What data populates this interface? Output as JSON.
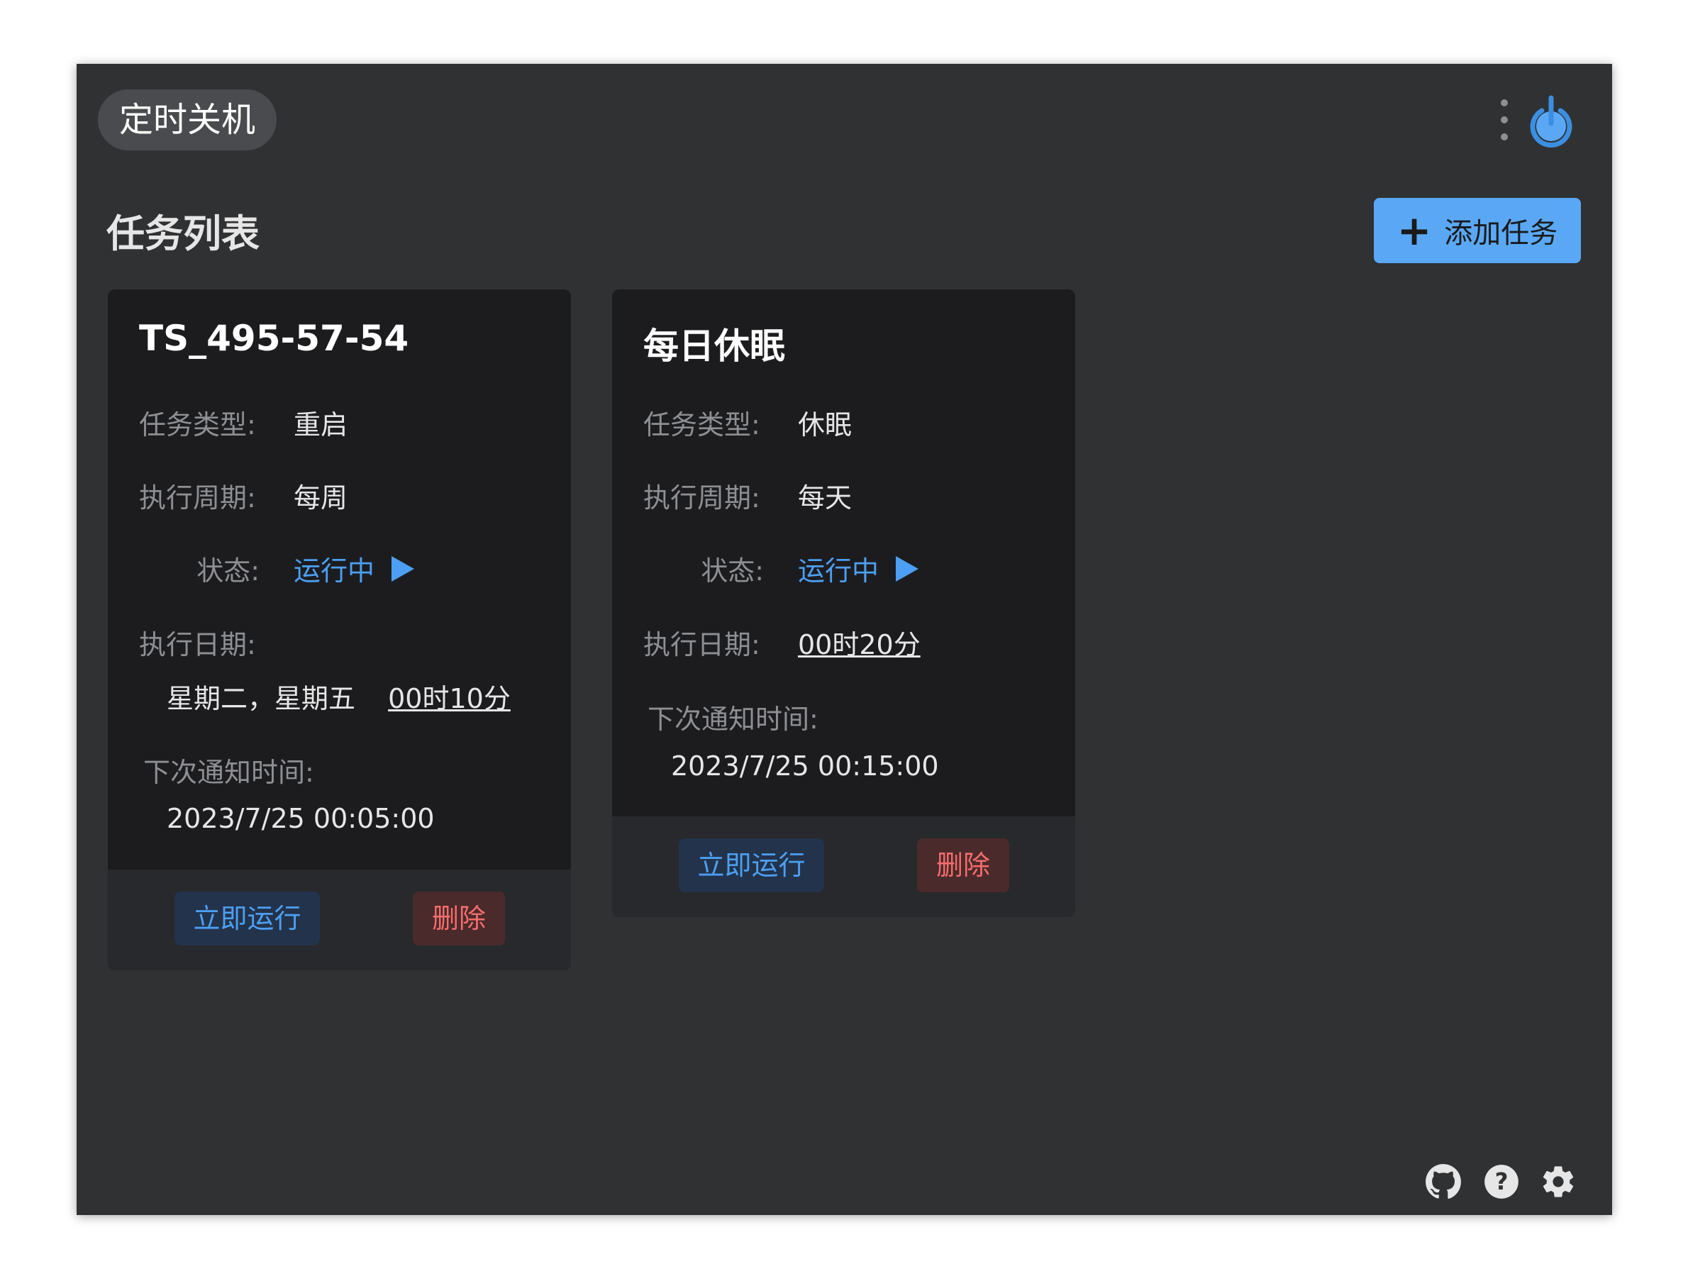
{
  "app": {
    "title": "定时关机"
  },
  "header": {
    "section_title": "任务列表",
    "add_button_label": "添加任务",
    "accent_color": "#5aa8f5"
  },
  "tasks": [
    {
      "name": "TS_495-57-54",
      "type_label": "任务类型:",
      "type_value": "重启",
      "cycle_label": "执行周期:",
      "cycle_value": "每周",
      "status_label": "状态:",
      "status_value": "运行中",
      "date_label": "执行日期:",
      "date_days": "星期二，星期五",
      "date_time": "00时10分",
      "next_label": "下次通知时间:",
      "next_value": "2023/7/25 00:05:00",
      "run_button": "立即运行",
      "delete_button": "删除"
    },
    {
      "name": "每日休眠",
      "type_label": "任务类型:",
      "type_value": "休眠",
      "cycle_label": "执行周期:",
      "cycle_value": "每天",
      "status_label": "状态:",
      "status_value": "运行中",
      "date_label": "执行日期:",
      "date_time": "00时20分",
      "next_label": "下次通知时间:",
      "next_value": "2023/7/25 00:15:00",
      "run_button": "立即运行",
      "delete_button": "删除"
    }
  ],
  "footer_icons": [
    "github-icon",
    "help-icon",
    "settings-icon"
  ],
  "colors": {
    "running": "#4c9ff2",
    "delete": "#f56c6c",
    "window_bg": "#303133",
    "card_bg": "#1c1c1f"
  }
}
